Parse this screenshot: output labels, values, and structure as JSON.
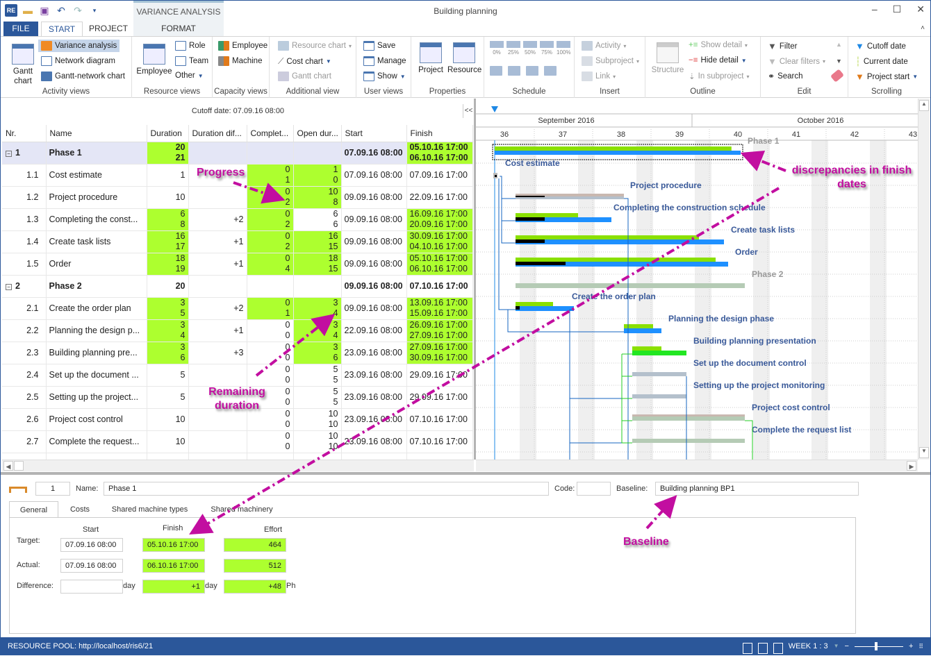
{
  "window": {
    "title": "Building planning",
    "context_tab_group": "VARIANCE ANALYSIS",
    "quick_access": [
      "app-icon",
      "open-folder-icon",
      "save-icon",
      "undo-icon",
      "redo-icon",
      "customize-icon"
    ],
    "controls": {
      "minimize": "‒",
      "maximize": "☐",
      "close": "✕",
      "collapse_ribbon": "˄"
    }
  },
  "tabs": [
    {
      "label": "FILE"
    },
    {
      "label": "START",
      "active": true
    },
    {
      "label": "PROJECT"
    },
    {
      "label": "FORMAT"
    }
  ],
  "ribbon": {
    "activity_views": {
      "label": "Activity views",
      "gantt": "Gantt\nchart",
      "gantt_line1": "Gantt",
      "gantt_line2": "chart",
      "items": [
        "Variance analysis",
        "Network diagram",
        "Gantt-network chart"
      ]
    },
    "resource_views": {
      "label": "Resource views",
      "employee": "Employee",
      "items": [
        "Role",
        "Team",
        "Other"
      ]
    },
    "capacity_views": {
      "label": "Capacity views",
      "items": [
        "Employee",
        "Machine"
      ]
    },
    "additional_view": {
      "label": "Additional view",
      "items": [
        "Resource chart",
        "Cost chart",
        "Gantt chart"
      ]
    },
    "user_views": {
      "label": "User views",
      "items": [
        "Save",
        "Manage",
        "Show"
      ]
    },
    "properties": {
      "label": "Properties",
      "items": [
        "Project",
        "Resource"
      ]
    },
    "schedule": {
      "label": "Schedule",
      "percent": [
        "0%",
        "25%",
        "50%",
        "75%",
        "100%"
      ]
    },
    "insert": {
      "label": "Insert",
      "items": [
        "Activity",
        "Subproject",
        "Link"
      ]
    },
    "outline": {
      "label": "Outline",
      "structure": "Structure",
      "items": [
        "Show detail",
        "Hide detail",
        "In subproject"
      ]
    },
    "edit": {
      "label": "Edit",
      "items": [
        "Filter",
        "Clear filters",
        "Search"
      ]
    },
    "scrolling": {
      "label": "Scrolling",
      "items": [
        "Cutoff date",
        "Current date",
        "Project start"
      ]
    }
  },
  "cutoff_label": "Cutoff date: 07.09.16 08:00",
  "collapse_label": "<<",
  "table": {
    "columns": [
      "Nr.",
      "Name",
      "Duration",
      "Duration dif...",
      "Complet...",
      "Open dur...",
      "Start",
      "Finish"
    ],
    "rows": [
      {
        "nr": "1",
        "name": "Phase 1",
        "phase": true,
        "dur": [
          "20",
          "21"
        ],
        "dur_hl": true,
        "diff": "",
        "comp": [],
        "comp_hl": false,
        "open": [],
        "open_hl": false,
        "start": "07.09.16 08:00",
        "finish": [
          "05.10.16 17:00",
          "06.10.16 17:00"
        ],
        "fin_hl": true
      },
      {
        "nr": "1.1",
        "name": "Cost estimate",
        "dur": [
          "1"
        ],
        "dur_hl": false,
        "diff": "",
        "comp": [
          "0",
          "1"
        ],
        "comp_hl": true,
        "open": [
          "1",
          "0"
        ],
        "open_hl": true,
        "start": "07.09.16 08:00",
        "finish": [
          "07.09.16 17:00"
        ],
        "fin_hl": false
      },
      {
        "nr": "1.2",
        "name": "Project procedure",
        "dur": [
          "10"
        ],
        "dur_hl": false,
        "diff": "",
        "comp": [
          "0",
          "2"
        ],
        "comp_hl": true,
        "open": [
          "10",
          "8"
        ],
        "open_hl": true,
        "start": "09.09.16 08:00",
        "finish": [
          "22.09.16 17:00"
        ],
        "fin_hl": false
      },
      {
        "nr": "1.3",
        "name": "Completing the const...",
        "dur": [
          "6",
          "8"
        ],
        "dur_hl": true,
        "diff": "+2",
        "comp": [
          "0",
          "2"
        ],
        "comp_hl": true,
        "open": [
          "6",
          "6"
        ],
        "open_hl": false,
        "start": "09.09.16 08:00",
        "finish": [
          "16.09.16 17:00",
          "20.09.16 17:00"
        ],
        "fin_hl": true
      },
      {
        "nr": "1.4",
        "name": "Create task lists",
        "dur": [
          "16",
          "17"
        ],
        "dur_hl": true,
        "diff": "+1",
        "comp": [
          "0",
          "2"
        ],
        "comp_hl": true,
        "open": [
          "16",
          "15"
        ],
        "open_hl": true,
        "start": "09.09.16 08:00",
        "finish": [
          "30.09.16 17:00",
          "04.10.16 17:00"
        ],
        "fin_hl": true
      },
      {
        "nr": "1.5",
        "name": "Order",
        "dur": [
          "18",
          "19"
        ],
        "dur_hl": true,
        "diff": "+1",
        "comp": [
          "0",
          "4"
        ],
        "comp_hl": true,
        "open": [
          "18",
          "15"
        ],
        "open_hl": true,
        "start": "09.09.16 08:00",
        "finish": [
          "05.10.16 17:00",
          "06.10.16 17:00"
        ],
        "fin_hl": true
      },
      {
        "nr": "2",
        "name": "Phase 2",
        "phase": true,
        "dur": [
          "20"
        ],
        "dur_hl": false,
        "diff": "",
        "comp": [],
        "comp_hl": false,
        "open": [],
        "open_hl": false,
        "start": "09.09.16 08:00",
        "finish": [
          "07.10.16 17:00"
        ],
        "fin_hl": false
      },
      {
        "nr": "2.1",
        "name": "Create the order plan",
        "dur": [
          "3",
          "5"
        ],
        "dur_hl": true,
        "diff": "+2",
        "comp": [
          "0",
          "1"
        ],
        "comp_hl": true,
        "open": [
          "3",
          "4"
        ],
        "open_hl": true,
        "start": "09.09.16 08:00",
        "finish": [
          "13.09.16 17:00",
          "15.09.16 17:00"
        ],
        "fin_hl": true
      },
      {
        "nr": "2.2",
        "name": "Planning the design p...",
        "dur": [
          "3",
          "4"
        ],
        "dur_hl": true,
        "diff": "+1",
        "comp": [
          "0",
          "0"
        ],
        "comp_hl": false,
        "open": [
          "3",
          "4"
        ],
        "open_hl": true,
        "start": "22.09.16 08:00",
        "finish": [
          "26.09.16 17:00",
          "27.09.16 17:00"
        ],
        "fin_hl": true
      },
      {
        "nr": "2.3",
        "name": "Building planning pre...",
        "dur": [
          "3",
          "6"
        ],
        "dur_hl": true,
        "diff": "+3",
        "comp": [
          "0",
          "0"
        ],
        "comp_hl": false,
        "open": [
          "3",
          "6"
        ],
        "open_hl": true,
        "start": "23.09.16 08:00",
        "finish": [
          "27.09.16 17:00",
          "30.09.16 17:00"
        ],
        "fin_hl": true
      },
      {
        "nr": "2.4",
        "name": "Set up the document ...",
        "dur": [
          "5"
        ],
        "dur_hl": false,
        "diff": "",
        "comp": [
          "0",
          "0"
        ],
        "comp_hl": false,
        "open": [
          "5",
          "5"
        ],
        "open_hl": false,
        "start": "23.09.16 08:00",
        "finish": [
          "29.09.16 17:00"
        ],
        "fin_hl": false
      },
      {
        "nr": "2.5",
        "name": "Setting up the project...",
        "dur": [
          "5"
        ],
        "dur_hl": false,
        "diff": "",
        "comp": [
          "0",
          "0"
        ],
        "comp_hl": false,
        "open": [
          "5",
          "5"
        ],
        "open_hl": false,
        "start": "23.09.16 08:00",
        "finish": [
          "29.09.16 17:00"
        ],
        "fin_hl": false
      },
      {
        "nr": "2.6",
        "name": "Project cost control",
        "dur": [
          "10"
        ],
        "dur_hl": false,
        "diff": "",
        "comp": [
          "0",
          "0"
        ],
        "comp_hl": false,
        "open": [
          "10",
          "10"
        ],
        "open_hl": false,
        "start": "23.09.16 08:00",
        "finish": [
          "07.10.16 17:00"
        ],
        "fin_hl": false
      },
      {
        "nr": "2.7",
        "name": "Complete the request...",
        "dur": [
          "10"
        ],
        "dur_hl": false,
        "diff": "",
        "comp": [
          "0",
          "0"
        ],
        "comp_hl": false,
        "open": [
          "10",
          "10"
        ],
        "open_hl": false,
        "start": "23.09.16 08:00",
        "finish": [
          "07.10.16 17:00"
        ],
        "fin_hl": false
      }
    ]
  },
  "gantt": {
    "months": [
      {
        "label": "September 2016"
      },
      {
        "label": "October 2016"
      }
    ],
    "weeks": [
      "36",
      "37",
      "38",
      "39",
      "40",
      "41",
      "42",
      "43"
    ],
    "colors": {
      "planned": "#8ae000",
      "actual": "#1e90ff",
      "progress": "#000000",
      "baseline_gray": "#b4c0cc",
      "phase2": "#b5cbb5",
      "link": "#1565c0",
      "link_critical": "#22cc22",
      "label": "#3a5a9a"
    },
    "bars": [
      {
        "label": "Phase 1",
        "label_gray": true
      },
      {
        "label": "Cost estimate"
      },
      {
        "label": "Project procedure"
      },
      {
        "label": "Completing the construction schedule"
      },
      {
        "label": "Create task lists"
      },
      {
        "label": "Order"
      },
      {
        "label": "Phase 2",
        "label_gray": true
      },
      {
        "label": "Create the order plan"
      },
      {
        "label": "Planning the design phase"
      },
      {
        "label": "Building planning presentation"
      },
      {
        "label": "Set up the document control"
      },
      {
        "label": "Setting up the project monitoring"
      },
      {
        "label": "Project cost control"
      },
      {
        "label": "Complete the request list"
      }
    ]
  },
  "detail": {
    "number": "1",
    "name_label": "Name:",
    "name_value": "Phase 1",
    "code_label": "Code:",
    "code_value": "",
    "baseline_label": "Baseline:",
    "baseline_value": "Building planning BP1",
    "tabs": [
      "General",
      "Costs",
      "Shared machine types",
      "Shared machinery"
    ],
    "col_headers": {
      "start": "Start",
      "finish": "Finish",
      "effort": "Effort"
    },
    "target": {
      "label": "Target:",
      "start": "07.09.16 08:00",
      "finish": "05.10.16 17:00",
      "effort": "464"
    },
    "actual": {
      "label": "Actual:",
      "start": "07.09.16 08:00",
      "finish": "06.10.16 17:00",
      "effort": "512"
    },
    "difference": {
      "label": "Difference:",
      "start": "",
      "start_unit": "day",
      "finish": "+1",
      "finish_unit": "day",
      "effort": "+48",
      "effort_unit": "Ph"
    }
  },
  "status": {
    "resource_pool": "RESOURCE POOL: http://localhost/ris6/21",
    "scale": "WEEK 1 : 3",
    "zoom_minus": "−",
    "zoom_plus": "+",
    "zoom_level": 0.45
  },
  "annotations": {
    "progress": "Progress",
    "remaining": "Remaining duration",
    "remaining_l1": "Remaining",
    "remaining_l2": "duration",
    "discrepancies_l1": "discrepancies in finish",
    "discrepancies_l2": "dates",
    "baseline": "Baseline",
    "color": "#c20ea0"
  }
}
